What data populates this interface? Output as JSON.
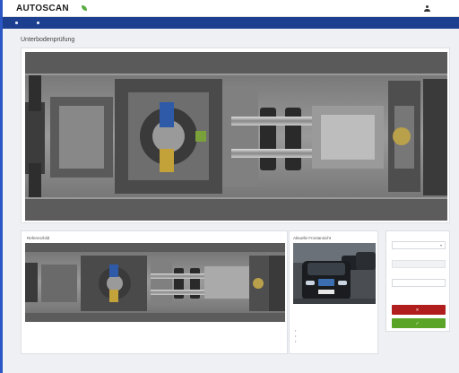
{
  "app": {
    "logo_main": "AUTO",
    "logo_accent": "SCAN",
    "tagline": ""
  },
  "header": {
    "user": "",
    "menu_1": "",
    "menu_2": ""
  },
  "nav": {
    "items": [
      {
        "label": ""
      },
      {
        "label": ""
      }
    ]
  },
  "page": {
    "title": "Unterbodenprüfung",
    "breadcrumb": ""
  },
  "reference": {
    "label": "Referenzbild"
  },
  "photo": {
    "label": "Aktuelle Frontansicht",
    "plate": ""
  },
  "checklist": {
    "title": "",
    "description": "",
    "items": [
      "",
      "",
      ""
    ]
  },
  "form": {
    "reference_label": "",
    "reference_value": "",
    "recognized_label": "",
    "recognized_value": "",
    "manual_label": "",
    "manual_value": "",
    "hint": "",
    "reject_label": "",
    "ok_label": ""
  },
  "footer": {
    "text": ""
  },
  "colors": {
    "nav": "#1d3f8f",
    "accent_strip": "#2b57c4",
    "reject": "#b01e1e",
    "ok": "#5aa528",
    "tagline": "#4b9f3a"
  }
}
